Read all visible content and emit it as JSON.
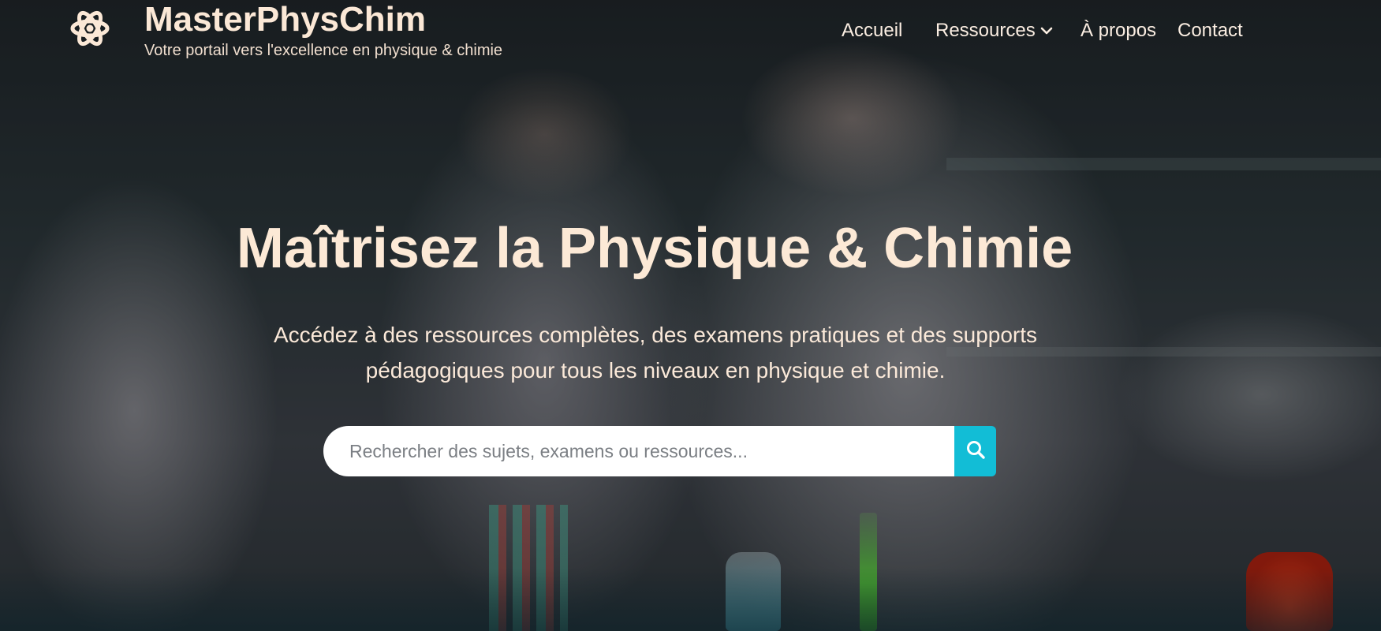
{
  "header": {
    "logo_icon": "atom-icon",
    "brand": "MasterPhysChim",
    "tagline": "Votre portail vers l'excellence en physique & chimie"
  },
  "nav": {
    "items": [
      {
        "label": "Accueil"
      },
      {
        "label": "Ressources",
        "icon": "chevron-down-icon"
      },
      {
        "label": "À propos"
      },
      {
        "label": "Contact"
      }
    ]
  },
  "hero": {
    "title": "Maîtrisez la Physique & Chimie",
    "subtitle": "Accédez à des ressources complètes, des examens pratiques et des supports pédagogiques pour tous les niveaux en physique et chimie.",
    "search": {
      "placeholder": "Rechercher des sujets, examens ou ressources...",
      "value": "",
      "button_icon": "search-icon"
    }
  },
  "colors": {
    "text_cream": "#fce9d6",
    "search_button": "#12bdd6",
    "input_bg": "#ffffff"
  }
}
